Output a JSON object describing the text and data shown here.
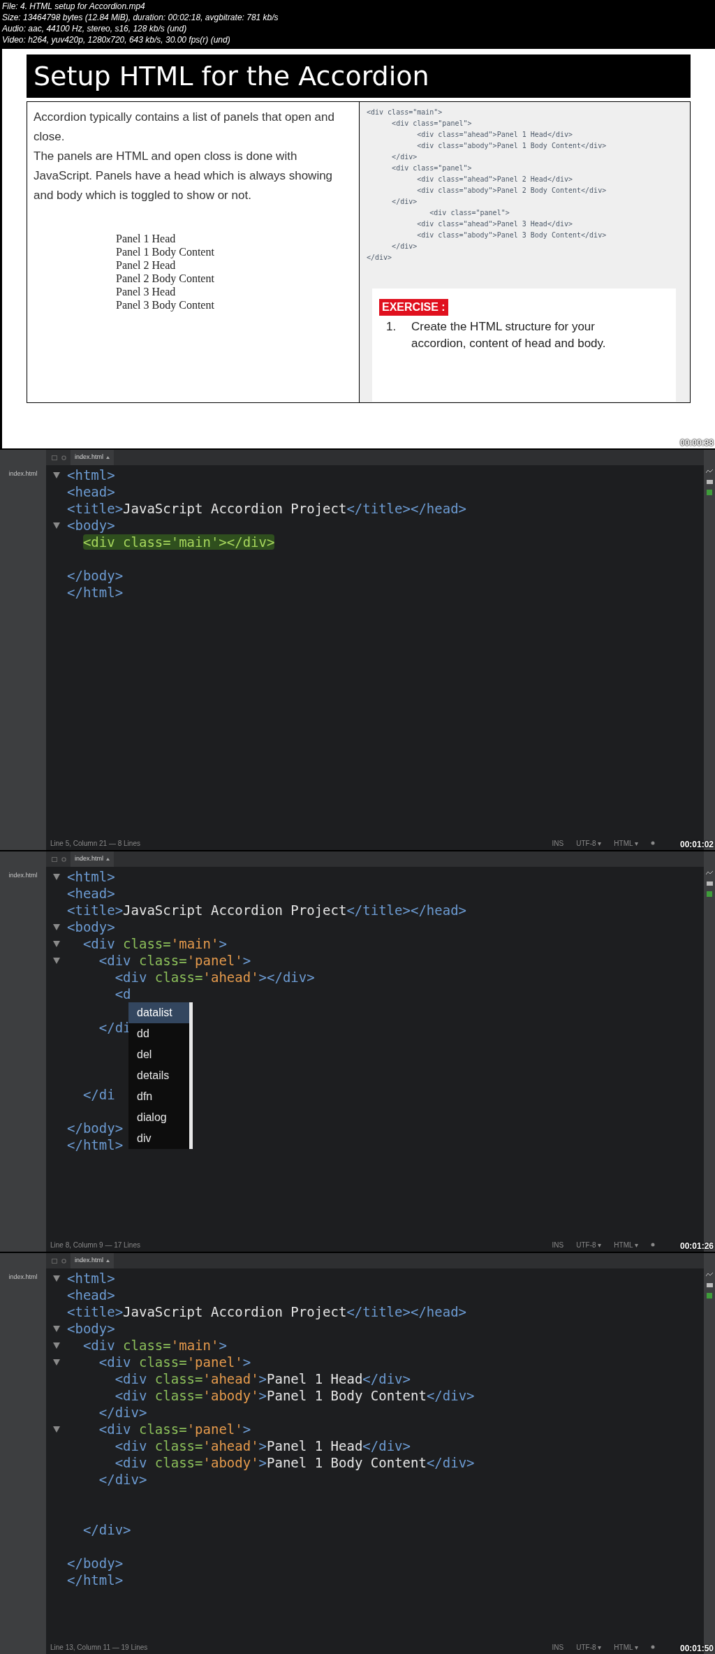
{
  "file_info": [
    "File: 4. HTML setup for Accordion.mp4",
    "Size: 13464798 bytes (12.84 MiB), duration: 00:02:18, avgbitrate: 781 kb/s",
    "Audio: aac, 44100 Hz, stereo, s16, 128 kb/s (und)",
    "Video: h264, yuv420p, 1280x720, 643 kb/s, 30.00 fps(r) (und)"
  ],
  "frames": [
    {
      "kind": "slide",
      "timestamp": "00:00:38",
      "title": "Setup HTML for the Accordion",
      "paragraphs": [
        "Accordion typically contains a list of panels that open and close.",
        "The panels are HTML and open closs is done with JavaScript.  Panels have a head which is always showing and body which is toggled to show or not."
      ],
      "panel_list": [
        "Panel 1 Head",
        "Panel 1 Body Content",
        "Panel 2 Head",
        "Panel 2 Body Content",
        "Panel 3 Head",
        "Panel 3 Body Content"
      ],
      "code_sample": [
        "<div class=\"main\">",
        "      <div class=\"panel\">",
        "            <div class=\"ahead\">Panel 1 Head</div>",
        "            <div class=\"abody\">Panel 1 Body Content</div>",
        "      </div>",
        "      <div class=\"panel\">",
        "            <div class=\"ahead\">Panel 2 Head</div>",
        "            <div class=\"abody\">Panel 2 Body Content</div>",
        "      </div>",
        "               <div class=\"panel\">",
        "            <div class=\"ahead\">Panel 3 Head</div>",
        "            <div class=\"abody\">Panel 3 Body Content</div>",
        "      </div>",
        "</div>"
      ],
      "exercise": {
        "label": "EXERCISE :",
        "number": "1.",
        "text": "Create the HTML structure for your accordion, content of head and body."
      }
    },
    {
      "kind": "editor",
      "timestamp": "00:01:02",
      "tab": "index.html",
      "sidebar_file": "index.html",
      "lines": [
        {
          "kind": "code",
          "text": "<html>",
          "fold": true,
          "highlighted": false
        },
        {
          "kind": "code",
          "text": "<head>",
          "fold": false,
          "highlighted": false
        },
        {
          "kind": "code",
          "text": "<title>JavaScript Accordion Project</title></head>",
          "fold": false,
          "highlighted": false
        },
        {
          "kind": "code",
          "text": "<body>",
          "fold": true,
          "highlighted": false
        },
        {
          "kind": "code",
          "text": "  <div class='main'></div>",
          "fold": false,
          "highlighted": true
        },
        {
          "kind": "blank"
        },
        {
          "kind": "code",
          "text": "</body>",
          "fold": false,
          "highlighted": false
        },
        {
          "kind": "code",
          "text": "</html>",
          "fold": false,
          "highlighted": false
        }
      ],
      "status": "Line 5, Column 21 — 8 Lines",
      "status_right": [
        {
          "label": "INS"
        },
        {
          "label": "UTF-8",
          "caret": "▾"
        },
        {
          "label": "HTML",
          "caret": "▾"
        }
      ]
    },
    {
      "kind": "editor",
      "timestamp": "00:01:26",
      "tab": "index.html",
      "sidebar_file": "index.html",
      "lines": [
        {
          "kind": "code",
          "text": "<html>",
          "fold": true,
          "highlighted": false
        },
        {
          "kind": "code",
          "text": "<head>",
          "fold": false,
          "highlighted": false
        },
        {
          "kind": "code",
          "text": "<title>JavaScript Accordion Project</title></head>",
          "fold": false,
          "highlighted": false
        },
        {
          "kind": "code",
          "text": "<body>",
          "fold": true,
          "highlighted": false
        },
        {
          "kind": "code",
          "text": "  <div class='main'>",
          "fold": true,
          "highlighted": false
        },
        {
          "kind": "code",
          "text": "    <div class='panel'>",
          "fold": true,
          "highlighted": false
        },
        {
          "kind": "code",
          "text": "      <div class='ahead'></div>",
          "fold": false,
          "highlighted": false
        },
        {
          "kind": "code",
          "text": "      <d",
          "fold": false,
          "highlighted": false
        },
        {
          "kind": "blank"
        },
        {
          "kind": "code",
          "text": "    </di",
          "fold": false,
          "highlighted": false
        },
        {
          "kind": "blank"
        },
        {
          "kind": "blank"
        },
        {
          "kind": "blank"
        },
        {
          "kind": "code",
          "text": "  </di",
          "fold": false,
          "highlighted": false
        },
        {
          "kind": "blank"
        },
        {
          "kind": "code",
          "text": "</body>",
          "fold": false,
          "highlighted": false
        },
        {
          "kind": "code",
          "text": "</html>",
          "fold": false,
          "highlighted": false
        }
      ],
      "autocomplete": [
        {
          "label": "datalist",
          "selected": true
        },
        {
          "label": "dd",
          "selected": false
        },
        {
          "label": "del",
          "selected": false
        },
        {
          "label": "details",
          "selected": false
        },
        {
          "label": "dfn",
          "selected": false
        },
        {
          "label": "dialog",
          "selected": false
        },
        {
          "label": "div",
          "selected": false
        }
      ],
      "status": "Line 8, Column 9 — 17 Lines",
      "status_right": [
        {
          "label": "INS"
        },
        {
          "label": "UTF-8",
          "caret": "▾"
        },
        {
          "label": "HTML",
          "caret": "▾"
        }
      ]
    },
    {
      "kind": "editor",
      "timestamp": "00:01:50",
      "tab": "index.html",
      "sidebar_file": "index.html",
      "lines": [
        {
          "kind": "code",
          "text": "<html>",
          "fold": true,
          "highlighted": false
        },
        {
          "kind": "code",
          "text": "<head>",
          "fold": false,
          "highlighted": false
        },
        {
          "kind": "code",
          "text": "<title>JavaScript Accordion Project</title></head>",
          "fold": false,
          "highlighted": false
        },
        {
          "kind": "code",
          "text": "<body>",
          "fold": true,
          "highlighted": false
        },
        {
          "kind": "code",
          "text": "  <div class='main'>",
          "fold": true,
          "highlighted": false
        },
        {
          "kind": "code",
          "text": "    <div class='panel'>",
          "fold": true,
          "highlighted": false
        },
        {
          "kind": "code",
          "text": "      <div class='ahead'>Panel 1 Head</div>",
          "fold": false,
          "highlighted": false
        },
        {
          "kind": "code",
          "text": "      <div class='abody'>Panel 1 Body Content</div>",
          "fold": false,
          "highlighted": false
        },
        {
          "kind": "code",
          "text": "    </div>",
          "fold": false,
          "highlighted": false
        },
        {
          "kind": "code",
          "text": "    <div class='panel'>",
          "fold": true,
          "highlighted": false
        },
        {
          "kind": "code",
          "text": "      <div class='ahead'>Panel 1 Head</div>",
          "fold": false,
          "highlighted": false
        },
        {
          "kind": "code",
          "text": "      <div class='abody'>Panel 1 Body Content</div>",
          "fold": false,
          "highlighted": false
        },
        {
          "kind": "code",
          "text": "    </div>",
          "fold": false,
          "highlighted": false
        },
        {
          "kind": "blank"
        },
        {
          "kind": "blank"
        },
        {
          "kind": "code",
          "text": "  </div>",
          "fold": false,
          "highlighted": false
        },
        {
          "kind": "blank"
        },
        {
          "kind": "code",
          "text": "</body>",
          "fold": false,
          "highlighted": false
        },
        {
          "kind": "code",
          "text": "</html>",
          "fold": false,
          "highlighted": false
        }
      ],
      "status": "Line 13, Column 11 — 19 Lines",
      "status_right": [
        {
          "label": "INS"
        },
        {
          "label": "UTF-8",
          "caret": "▾"
        },
        {
          "label": "HTML",
          "caret": "▾"
        }
      ]
    }
  ]
}
